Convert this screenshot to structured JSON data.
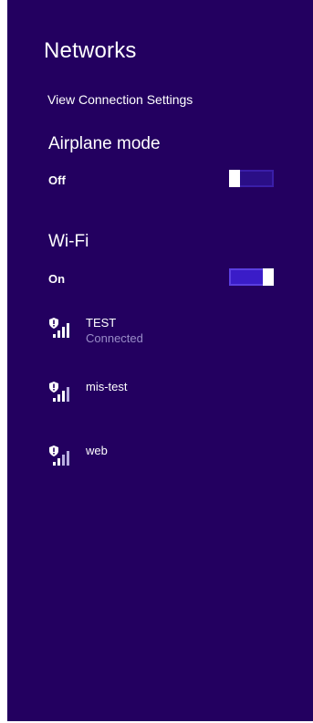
{
  "panel": {
    "title": "Networks",
    "connection_settings_link": "View Connection Settings"
  },
  "airplane_mode": {
    "heading": "Airplane mode",
    "state_label": "Off",
    "enabled": false
  },
  "wifi": {
    "heading": "Wi-Fi",
    "state_label": "On",
    "enabled": true,
    "networks": [
      {
        "name": "TEST",
        "status": "Connected",
        "icon": "secured-wifi-signal-icon"
      },
      {
        "name": "mis-test",
        "status": "",
        "icon": "secured-wifi-signal-icon"
      },
      {
        "name": "web",
        "status": "",
        "icon": "secured-wifi-signal-icon"
      }
    ]
  },
  "colors": {
    "background": "#230060",
    "toggle_on": "#3a1cc8",
    "toggle_off": "#2a0e86",
    "secondary_text": "#9a8cc8"
  }
}
